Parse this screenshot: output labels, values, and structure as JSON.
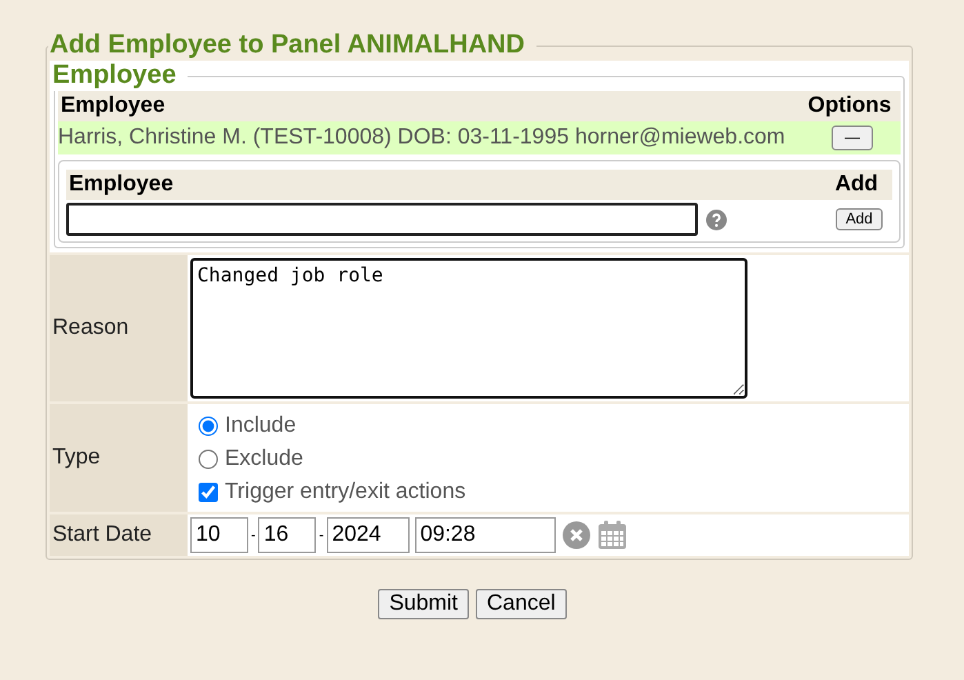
{
  "title": "Add Employee to Panel ANIMALHAND",
  "employee_section": {
    "title": "Employee",
    "columns": [
      "Employee",
      "Options"
    ],
    "rows": [
      {
        "text": "Harris, Christine M. (TEST-10008) DOB: 03-11-1995 horner@mieweb.com",
        "remove_label": "—"
      }
    ],
    "add": {
      "columns": [
        "Employee",
        "Add"
      ],
      "button": "Add"
    }
  },
  "reason": {
    "label": "Reason",
    "value": "Changed job role"
  },
  "type": {
    "label": "Type",
    "options": [
      {
        "label": "Include",
        "selected": true
      },
      {
        "label": "Exclude",
        "selected": false
      }
    ],
    "trigger": {
      "label": "Trigger entry/exit actions",
      "checked": true
    }
  },
  "start_date": {
    "label": "Start Date",
    "month": "10",
    "day": "16",
    "year": "2024",
    "time": "09:28",
    "separators": [
      "-",
      "-"
    ]
  },
  "buttons": [
    "Submit",
    "Cancel"
  ]
}
